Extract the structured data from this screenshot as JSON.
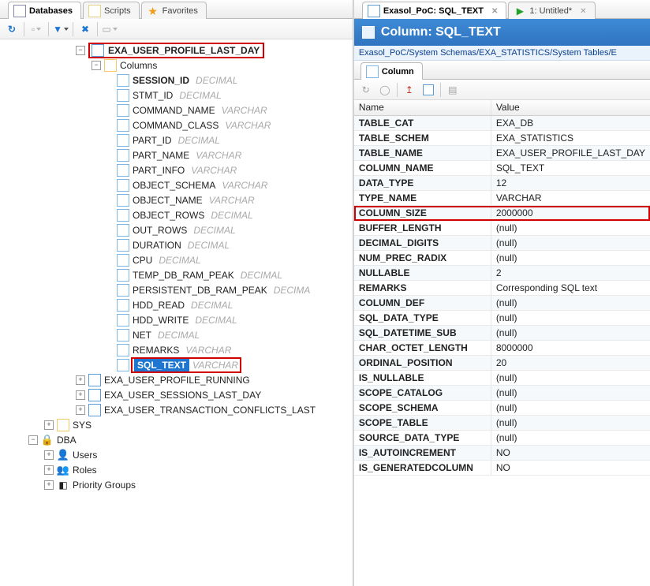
{
  "left": {
    "tabs": [
      {
        "label": "Databases",
        "active": true
      },
      {
        "label": "Scripts"
      },
      {
        "label": "Favorites"
      }
    ],
    "selected_table": "EXA_USER_PROFILE_LAST_DAY",
    "columns_label": "Columns",
    "columns": [
      {
        "name": "SESSION_ID",
        "type": "DECIMAL",
        "bold": true
      },
      {
        "name": "STMT_ID",
        "type": "DECIMAL"
      },
      {
        "name": "COMMAND_NAME",
        "type": "VARCHAR"
      },
      {
        "name": "COMMAND_CLASS",
        "type": "VARCHAR"
      },
      {
        "name": "PART_ID",
        "type": "DECIMAL"
      },
      {
        "name": "PART_NAME",
        "type": "VARCHAR"
      },
      {
        "name": "PART_INFO",
        "type": "VARCHAR"
      },
      {
        "name": "OBJECT_SCHEMA",
        "type": "VARCHAR"
      },
      {
        "name": "OBJECT_NAME",
        "type": "VARCHAR"
      },
      {
        "name": "OBJECT_ROWS",
        "type": "DECIMAL"
      },
      {
        "name": "OUT_ROWS",
        "type": "DECIMAL"
      },
      {
        "name": "DURATION",
        "type": "DECIMAL"
      },
      {
        "name": "CPU",
        "type": "DECIMAL"
      },
      {
        "name": "TEMP_DB_RAM_PEAK",
        "type": "DECIMAL"
      },
      {
        "name": "PERSISTENT_DB_RAM_PEAK",
        "type": "DECIMA"
      },
      {
        "name": "HDD_READ",
        "type": "DECIMAL"
      },
      {
        "name": "HDD_WRITE",
        "type": "DECIMAL"
      },
      {
        "name": "NET",
        "type": "DECIMAL"
      },
      {
        "name": "REMARKS",
        "type": "VARCHAR"
      },
      {
        "name": "SQL_TEXT",
        "type": "VARCHAR",
        "selected": true
      }
    ],
    "sibling_tables": [
      "EXA_USER_PROFILE_RUNNING",
      "EXA_USER_SESSIONS_LAST_DAY",
      "EXA_USER_TRANSACTION_CONFLICTS_LAST"
    ],
    "sys_node": "SYS",
    "dba_node": "DBA",
    "dba_children": [
      "Users",
      "Roles",
      "Priority Groups"
    ]
  },
  "right": {
    "tabs": [
      {
        "label": "Exasol_PoC: SQL_TEXT",
        "closable": true,
        "active": true
      },
      {
        "label": "1: Untitled*",
        "closable": true,
        "play": true
      }
    ],
    "header": "Column: SQL_TEXT",
    "breadcrumb": "Exasol_PoC/System Schemas/EXA_STATISTICS/System Tables/E",
    "subtab": "Column",
    "grid_headers": {
      "name": "Name",
      "value": "Value"
    },
    "properties": [
      {
        "name": "TABLE_CAT",
        "value": "EXA_DB"
      },
      {
        "name": "TABLE_SCHEM",
        "value": "EXA_STATISTICS"
      },
      {
        "name": "TABLE_NAME",
        "value": "EXA_USER_PROFILE_LAST_DAY"
      },
      {
        "name": "COLUMN_NAME",
        "value": "SQL_TEXT"
      },
      {
        "name": "DATA_TYPE",
        "value": "12"
      },
      {
        "name": "TYPE_NAME",
        "value": "VARCHAR"
      },
      {
        "name": "COLUMN_SIZE",
        "value": "2000000",
        "highlight": true
      },
      {
        "name": "BUFFER_LENGTH",
        "value": "(null)"
      },
      {
        "name": "DECIMAL_DIGITS",
        "value": "(null)"
      },
      {
        "name": "NUM_PREC_RADIX",
        "value": "(null)"
      },
      {
        "name": "NULLABLE",
        "value": "2"
      },
      {
        "name": "REMARKS",
        "value": "Corresponding SQL text"
      },
      {
        "name": "COLUMN_DEF",
        "value": "(null)"
      },
      {
        "name": "SQL_DATA_TYPE",
        "value": "(null)"
      },
      {
        "name": "SQL_DATETIME_SUB",
        "value": "(null)"
      },
      {
        "name": "CHAR_OCTET_LENGTH",
        "value": "8000000"
      },
      {
        "name": "ORDINAL_POSITION",
        "value": "20"
      },
      {
        "name": "IS_NULLABLE",
        "value": "(null)"
      },
      {
        "name": "SCOPE_CATALOG",
        "value": "(null)"
      },
      {
        "name": "SCOPE_SCHEMA",
        "value": "(null)"
      },
      {
        "name": "SCOPE_TABLE",
        "value": "(null)"
      },
      {
        "name": "SOURCE_DATA_TYPE",
        "value": "(null)"
      },
      {
        "name": "IS_AUTOINCREMENT",
        "value": "NO"
      },
      {
        "name": "IS_GENERATEDCOLUMN",
        "value": "NO"
      }
    ]
  }
}
